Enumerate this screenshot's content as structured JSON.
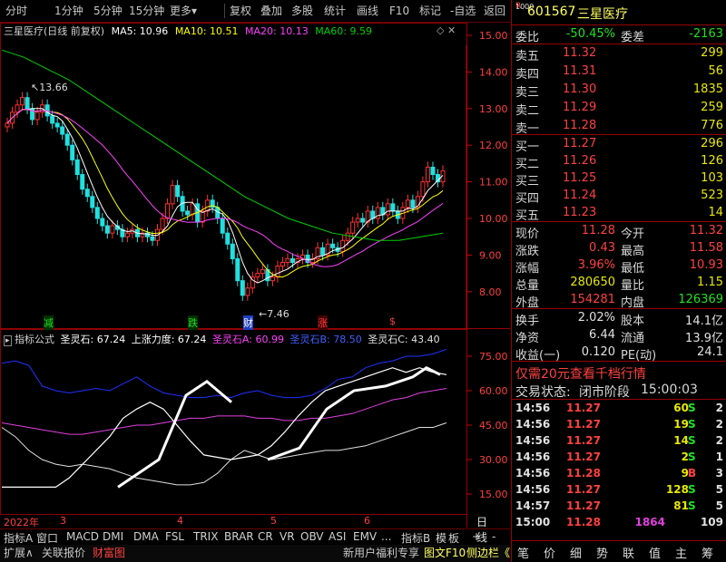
{
  "toolbar": {
    "items": [
      "分时",
      "1分钟",
      "5分钟",
      "15分钟",
      "更多",
      "复权",
      "叠加",
      "多股",
      "统计",
      "画线",
      "F10",
      "标记",
      "-自选",
      "返回"
    ]
  },
  "chart": {
    "title": "三星医疗",
    "adjust": "(日线 前复权)",
    "ma5": "MA5: 10.96",
    "ma10": "MA10: 10.51",
    "ma20": "MA20: 10.13",
    "ma60": "MA60: 9.59",
    "price_axis": [
      "15.00",
      "14.00",
      "13.00",
      "12.00",
      "11.00",
      "10.00",
      "9.00",
      "8.00"
    ],
    "high_marker": "13.66",
    "low_marker": "7.46",
    "events": [
      "减",
      "跌",
      "财",
      "涨",
      "$"
    ],
    "colors": {
      "ma5": "#ffffff",
      "ma10": "#ffff00",
      "ma20": "#ff40ff",
      "ma60": "#00d000",
      "up": "#ff3030",
      "down": "#20e0e0"
    }
  },
  "indicator": {
    "name": "指标公式",
    "values": [
      "圣灵石: 67.24",
      "上涨力度: 67.24",
      "圣灵石A: 60.99",
      "圣灵石B: 78.50",
      "圣灵石C: 43.40"
    ],
    "axis": [
      "75.00",
      "60.00",
      "45.00",
      "30.00",
      "15.00"
    ]
  },
  "date_axis": [
    "2022年",
    "3",
    "4",
    "5",
    "6"
  ],
  "period": "日线",
  "indicator_tabs": [
    "指标A",
    "窗口",
    "MACD",
    "DMI",
    "DMA",
    "FSL",
    "TRIX",
    "BRAR",
    "CR",
    "VR",
    "OBV",
    "ASI",
    "EMV",
    "...",
    "指标B",
    "模",
    "板",
    "+",
    "-"
  ],
  "bottom_tabs": [
    "扩展∧",
    "关联报价",
    "财富图"
  ],
  "bottom_right": [
    "新用户福利专享",
    "图文F10",
    "侧边栏《"
  ],
  "quote": {
    "code": "601567",
    "name": "三星医疗",
    "badge": "R",
    "weibi_label": "委比",
    "weibi": "-50.45%",
    "weicha_label": "委差",
    "weicha": "-2163",
    "asks": [
      {
        "label": "卖五",
        "price": "11.32",
        "vol": "299"
      },
      {
        "label": "卖四",
        "price": "11.31",
        "vol": "56"
      },
      {
        "label": "卖三",
        "price": "11.30",
        "vol": "1835"
      },
      {
        "label": "卖二",
        "price": "11.29",
        "vol": "259"
      },
      {
        "label": "卖一",
        "price": "11.28",
        "vol": "776"
      }
    ],
    "bids": [
      {
        "label": "买一",
        "price": "11.27",
        "vol": "296"
      },
      {
        "label": "买二",
        "price": "11.26",
        "vol": "126"
      },
      {
        "label": "买三",
        "price": "11.25",
        "vol": "103"
      },
      {
        "label": "买四",
        "price": "11.24",
        "vol": "523"
      },
      {
        "label": "买五",
        "price": "11.23",
        "vol": "14"
      }
    ],
    "stats": [
      {
        "l1": "现价",
        "v1": "11.28",
        "l2": "今开",
        "v2": "11.32"
      },
      {
        "l1": "涨跌",
        "v1": "0.43",
        "l2": "最高",
        "v2": "11.58"
      },
      {
        "l1": "涨幅",
        "v1": "3.96%",
        "l2": "最低",
        "v2": "10.93"
      },
      {
        "l1": "总量",
        "v1": "280650",
        "l2": "量比",
        "v2": "1.15"
      },
      {
        "l1": "外盘",
        "v1": "154281",
        "l2": "内盘",
        "v2": "126369"
      }
    ],
    "fundamentals": [
      {
        "l1": "换手",
        "v1": "2.02%",
        "l2": "股本",
        "v2": "14.1亿"
      },
      {
        "l1": "净资",
        "v1": "6.44",
        "l2": "流通",
        "v2": "13.9亿"
      },
      {
        "l1": "收益(一)",
        "v1": "0.120",
        "l2": "PE(动)",
        "v2": "24.1"
      }
    ],
    "promo": "仅需20元查看千档行情",
    "status_label": "交易状态:",
    "status": "闭市阶段",
    "status_time": "15:00:03",
    "ticks": [
      {
        "t": "14:56",
        "p": "11.27",
        "v": "60",
        "bs": "S",
        "n": "2"
      },
      {
        "t": "14:56",
        "p": "11.27",
        "v": "19",
        "bs": "S",
        "n": "2"
      },
      {
        "t": "14:56",
        "p": "11.27",
        "v": "14",
        "bs": "S",
        "n": "2"
      },
      {
        "t": "14:56",
        "p": "11.27",
        "v": "2",
        "bs": "S",
        "n": "1"
      },
      {
        "t": "14:56",
        "p": "11.28",
        "v": "9",
        "bs": "B",
        "n": "3"
      },
      {
        "t": "14:56",
        "p": "11.27",
        "v": "128",
        "bs": "S",
        "n": "5"
      },
      {
        "t": "14:57",
        "p": "11.27",
        "v": "81",
        "bs": "S",
        "n": "5"
      },
      {
        "t": "15:00",
        "p": "11.28",
        "v": "1864",
        "bs": "",
        "n": "109"
      }
    ],
    "bottom_icons": [
      "笔",
      "价",
      "细",
      "势",
      "联",
      "值",
      "主",
      "筹"
    ]
  }
}
